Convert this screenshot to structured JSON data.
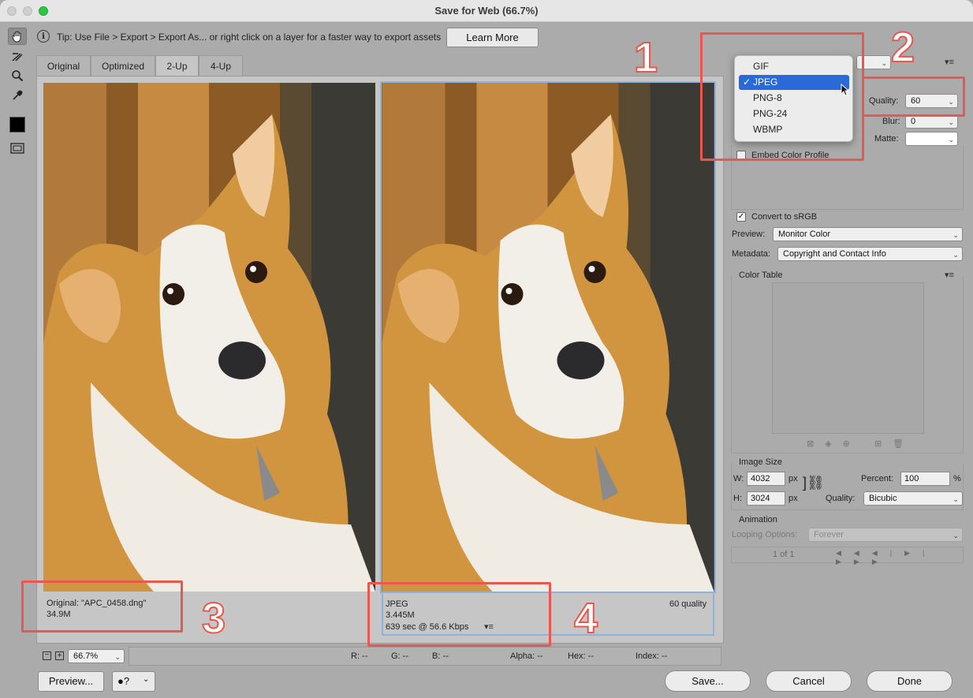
{
  "window": {
    "title": "Save for Web (66.7%)"
  },
  "tip": {
    "icon": "info-icon",
    "text": "Tip: Use File > Export > Export As...  or right click on a layer for a faster way to export assets",
    "learn_more": "Learn More"
  },
  "tools": [
    "hand-tool-icon",
    "slice-select-tool-icon",
    "zoom-tool-icon",
    "eyedropper-tool-icon",
    "color-swatch",
    "toggle-slices-icon"
  ],
  "tabs": [
    "Original",
    "Optimized",
    "2-Up",
    "4-Up"
  ],
  "left_panel": {
    "line1": "Original: \"APC_0458.dng\"",
    "line2": "34.9M"
  },
  "right_panel_info": {
    "format": "JPEG",
    "size": "3.445M",
    "time": "639 sec @ 56.6 Kbps",
    "quality": "60 quality"
  },
  "zoom": {
    "value": "66.7%"
  },
  "status": {
    "r": "R: --",
    "g": "G: --",
    "b": "B: --",
    "alpha": "Alpha: --",
    "hex": "Hex: --",
    "index": "Index: --"
  },
  "buttons": {
    "preview": "Preview...",
    "save": "Save...",
    "cancel": "Cancel",
    "done": "Done"
  },
  "format_menu": {
    "items": [
      "GIF",
      "JPEG",
      "PNG-8",
      "PNG-24",
      "WBMP"
    ],
    "selected": "JPEG",
    "check": "✓"
  },
  "settings": {
    "quality_label": "Quality:",
    "quality_value": "60",
    "blur_label": "Blur:",
    "blur_value": "0",
    "matte_label": "Matte:",
    "embed_color": "Embed Color Profile",
    "convert_srgb": "Convert to sRGB",
    "preview_label": "Preview:",
    "preview_value": "Monitor Color",
    "metadata_label": "Metadata:",
    "metadata_value": "Copyright and Contact Info",
    "color_table": "Color Table"
  },
  "image_size": {
    "title": "Image Size",
    "w_label": "W:",
    "w_value": "4032",
    "h_label": "H:",
    "h_value": "3024",
    "unit": "px",
    "percent_label": "Percent:",
    "percent_value": "100",
    "percent_unit": "%",
    "quality_label": "Quality:",
    "quality_value": "Bicubic"
  },
  "animation": {
    "title": "Animation",
    "looping_label": "Looping Options:",
    "looping_value": "Forever",
    "frame": "1 of 1"
  },
  "annotations": [
    "1",
    "2",
    "3",
    "4"
  ],
  "colors": {
    "accent": "#2a6ad8",
    "annotation": "#e8584e"
  }
}
